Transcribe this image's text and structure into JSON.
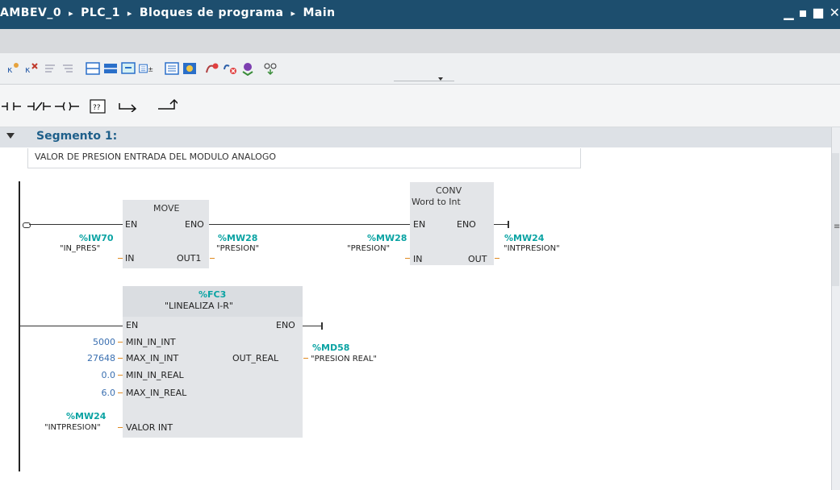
{
  "titlebar": {
    "crumbs": [
      "AMBEV_0",
      "PLC_1",
      "Bloques de programa",
      "Main"
    ],
    "separator": "▸"
  },
  "segment": {
    "title": "Segmento 1:",
    "comment": "VALOR DE PRESION ENTRADA DEL MODULO ANALOGO"
  },
  "move": {
    "name": "MOVE",
    "en": "EN",
    "eno": "ENO",
    "in_pin": "IN",
    "out_pin": "OUT1",
    "in_addr": "%IW70",
    "in_tag": "\"IN_PRES\"",
    "out_addr": "%MW28",
    "out_tag": "\"PRESION\""
  },
  "conv": {
    "name": "CONV",
    "subtitle": "Word to Int",
    "en": "EN",
    "eno": "ENO",
    "in_pin": "IN",
    "out_pin": "OUT",
    "in_addr": "%MW28",
    "in_tag": "\"PRESION\"",
    "out_addr": "%MW24",
    "out_tag": "\"INTPRESION\""
  },
  "fc": {
    "addr": "%FC3",
    "name": "\"LINEALIZA I-R\"",
    "en": "EN",
    "eno": "ENO",
    "pins": [
      "MIN_IN_INT",
      "MAX_IN_INT",
      "MIN_IN_REAL",
      "MAX_IN_REAL",
      "VALOR INT"
    ],
    "values": [
      "5000",
      "27648",
      "0.0",
      "6.0"
    ],
    "valor_addr": "%MW24",
    "valor_tag": "\"INTPRESION\"",
    "out_pin": "OUT_REAL",
    "out_addr": "%MD58",
    "out_tag": "\"PRESION REAL\""
  }
}
